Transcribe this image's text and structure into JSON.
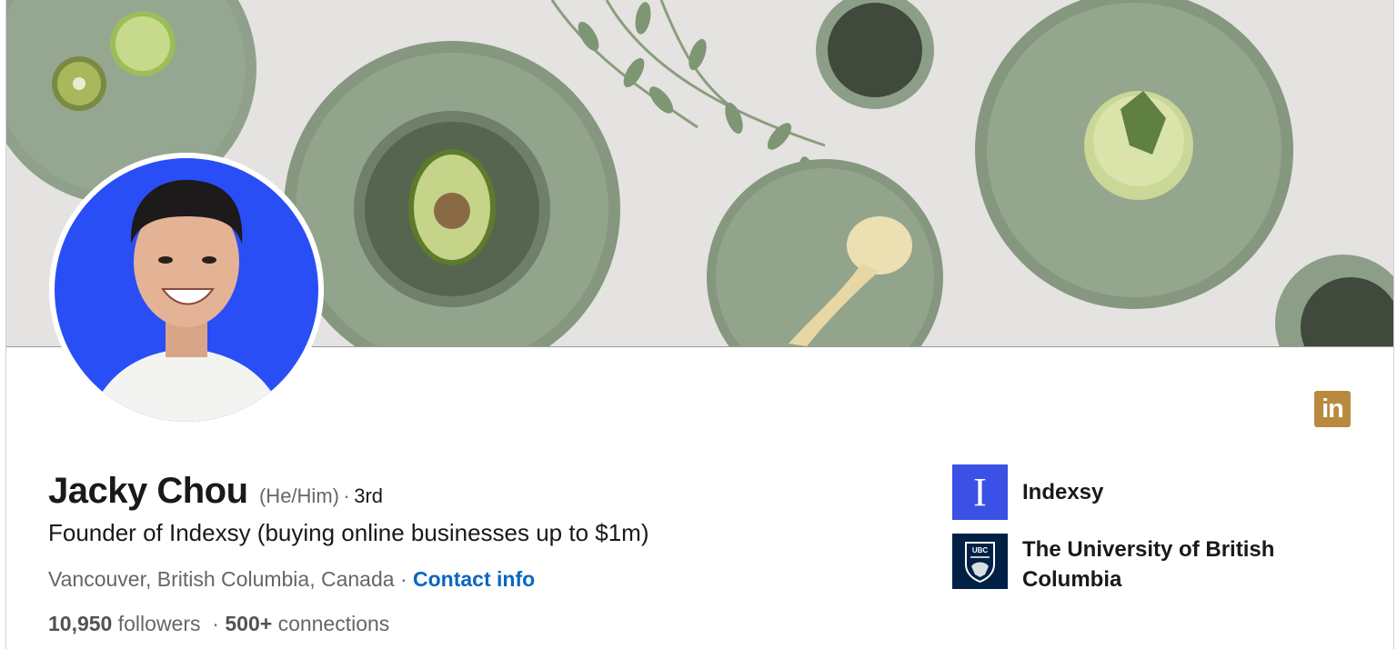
{
  "profile": {
    "name": "Jacky Chou",
    "pronouns": "(He/Him)",
    "separator": "·",
    "degree": "3rd",
    "headline": "Founder of Indexsy (buying online businesses up to $1m)",
    "location": "Vancouver, British Columbia, Canada",
    "contact_link": "Contact info",
    "followers_count": "10,950",
    "followers_label": "followers",
    "connections_count": "500+",
    "connections_label": "connections"
  },
  "badge": {
    "label": "in",
    "icon": "linkedin-icon",
    "color": "#b98a3e"
  },
  "organizations": [
    {
      "name": "Indexsy",
      "logo_letter": "I",
      "logo_color": "#3b50e5"
    },
    {
      "name": "The University of British Columbia",
      "logo_text": "UBC",
      "logo_color": "#002145"
    }
  ],
  "colors": {
    "link": "#0a66c2",
    "banner_plate": "#8d9e88",
    "banner_cloth": "#e4e3e1",
    "avatar_bg": "#2a4ef5"
  }
}
